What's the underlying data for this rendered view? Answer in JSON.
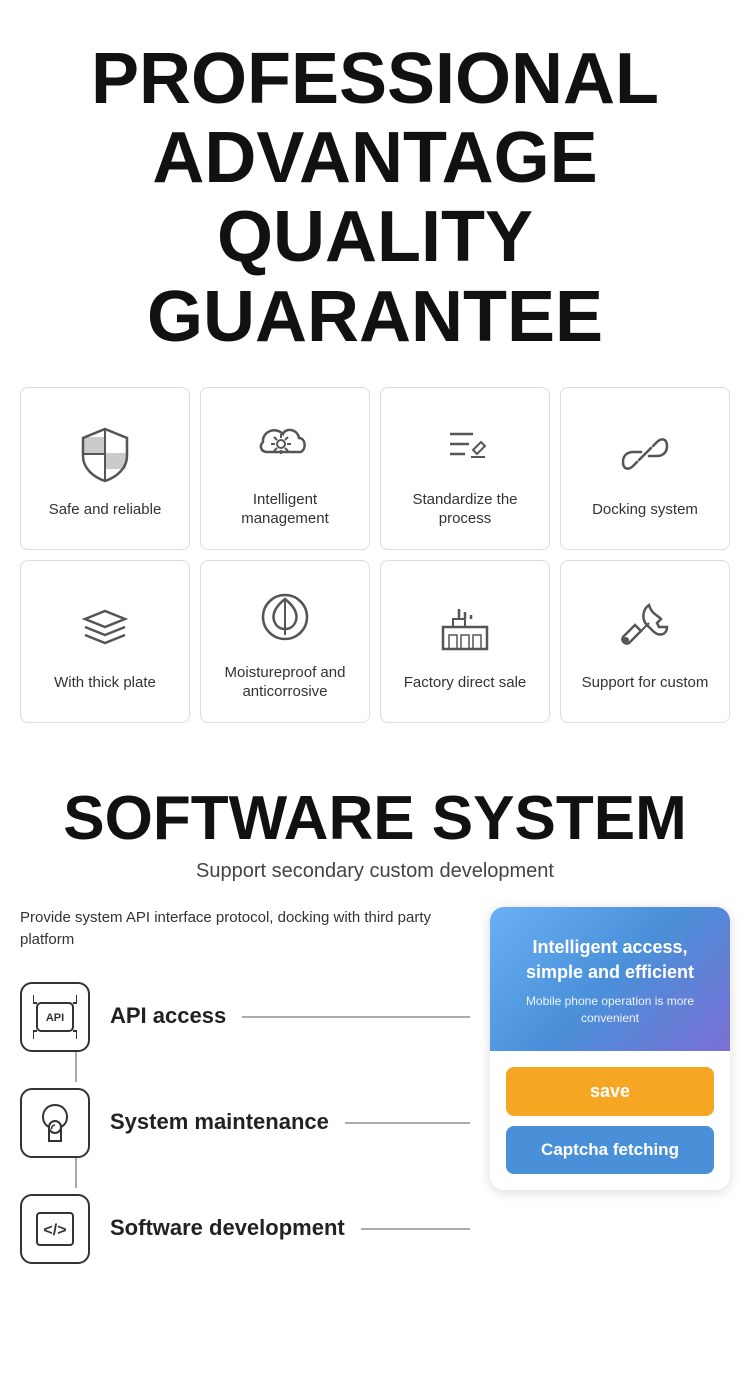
{
  "header": {
    "line1": "PROFESSIONAL",
    "line2": "ADVANTAGE",
    "line3": "QUALITY GUARANTEE"
  },
  "features_row1": [
    {
      "id": "safe-reliable",
      "label": "Safe and reliable",
      "icon": "shield"
    },
    {
      "id": "intelligent-management",
      "label": "Intelligent management",
      "icon": "cloud-settings"
    },
    {
      "id": "standardize-process",
      "label": "Standardize the process",
      "icon": "pen-list"
    },
    {
      "id": "docking-system",
      "label": "Docking system",
      "icon": "link"
    }
  ],
  "features_row2": [
    {
      "id": "thick-plate",
      "label": "With thick plate",
      "icon": "layers"
    },
    {
      "id": "moistureproof",
      "label": "Moistureproof and anticorrosive",
      "icon": "leaf-circle"
    },
    {
      "id": "factory-direct",
      "label": "Factory direct sale",
      "icon": "factory"
    },
    {
      "id": "support-custom",
      "label": "Support for custom",
      "icon": "tools"
    }
  ],
  "software": {
    "title": "SOFTWARE SYSTEM",
    "subtitle": "Support secondary custom development",
    "desc": "Provide system API interface protocol, docking with third party platform",
    "items": [
      {
        "id": "api-access",
        "label": "API access",
        "icon": "api"
      },
      {
        "id": "system-maintenance",
        "label": "System maintenance",
        "icon": "maintenance"
      },
      {
        "id": "software-development",
        "label": "Software development",
        "icon": "code"
      }
    ],
    "panel": {
      "title": "Intelligent access, simple and efficient",
      "subtitle": "Mobile phone operation is more convenient",
      "save_label": "save",
      "captcha_label": "Captcha fetching"
    }
  }
}
